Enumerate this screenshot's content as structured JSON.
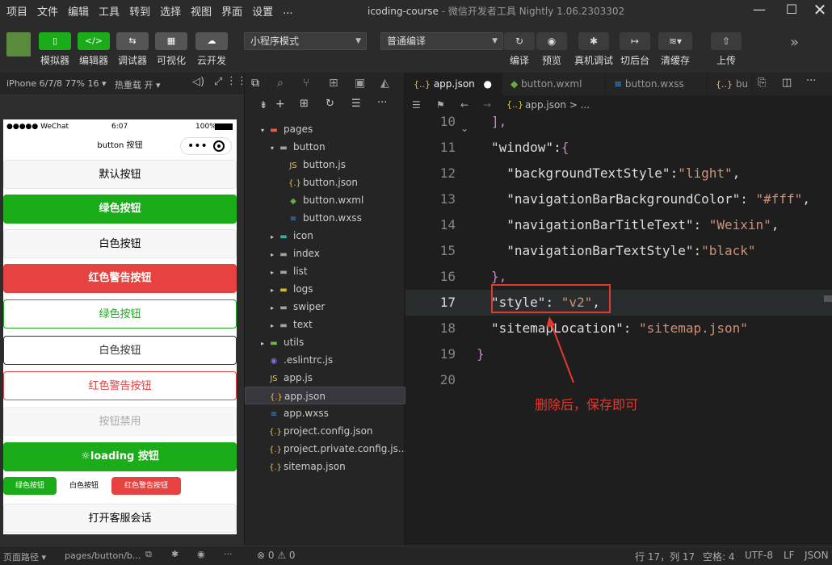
{
  "menu": [
    "项目",
    "文件",
    "编辑",
    "工具",
    "转到",
    "选择",
    "视图",
    "界面",
    "设置",
    "..."
  ],
  "window": {
    "title_app": "icoding-course",
    "title_rest": " - 微信开发者工具 Nightly 1.06.2303302"
  },
  "toolbar": {
    "simulator": "模拟器",
    "editor": "编辑器",
    "debugger": "调试器",
    "visual": "可视化",
    "cloud": "云开发",
    "mode_select": "小程序模式",
    "compile_select": "普通编译",
    "compile": "编译",
    "preview": "预览",
    "realdebug": "真机调试",
    "background": "切后台",
    "clearcache": "清缓存",
    "upload": "上传"
  },
  "simulator": {
    "device": "iPhone 6/7/8 77% 16",
    "hotreload": "热重载 开",
    "carrier": "●●●●● WeChat",
    "time": "6:07",
    "battery": "100%",
    "nav_title": "button 按钮",
    "buttons": {
      "default": "默认按钮",
      "green": "绿色按钮",
      "white": "白色按钮",
      "red": "红色警告按钮",
      "green_plain": "绿色按钮",
      "white_plain": "白色按钮",
      "red_plain": "红色警告按钮",
      "disabled": "按钮禁用",
      "loading": "loading 按钮",
      "mini_green": "绿色按钮",
      "mini_white": "白色按钮",
      "mini_red": "红色警告按钮",
      "contact": "打开客服会话"
    },
    "page_path_label": "页面路径",
    "page_path": "pages/button/b..."
  },
  "tree": [
    {
      "name": "pages",
      "depth": 0,
      "type": "folder-red",
      "caret": "▾"
    },
    {
      "name": "button",
      "depth": 1,
      "type": "folder",
      "caret": "▾"
    },
    {
      "name": "button.js",
      "depth": 2,
      "type": "js"
    },
    {
      "name": "button.json",
      "depth": 2,
      "type": "json"
    },
    {
      "name": "button.wxml",
      "depth": 2,
      "type": "wxml"
    },
    {
      "name": "button.wxss",
      "depth": 2,
      "type": "wxss"
    },
    {
      "name": "icon",
      "depth": 1,
      "type": "folder-teal",
      "caret": "▸"
    },
    {
      "name": "index",
      "depth": 1,
      "type": "folder",
      "caret": "▸"
    },
    {
      "name": "list",
      "depth": 1,
      "type": "folder",
      "caret": "▸"
    },
    {
      "name": "logs",
      "depth": 1,
      "type": "folder-yellow",
      "caret": "▸"
    },
    {
      "name": "swiper",
      "depth": 1,
      "type": "folder",
      "caret": "▸"
    },
    {
      "name": "text",
      "depth": 1,
      "type": "folder",
      "caret": "▸"
    },
    {
      "name": "utils",
      "depth": 0,
      "type": "folder-green",
      "caret": "▸"
    },
    {
      "name": ".eslintrc.js",
      "depth": 0,
      "type": "eslint"
    },
    {
      "name": "app.js",
      "depth": 0,
      "type": "js"
    },
    {
      "name": "app.json",
      "depth": 0,
      "type": "json",
      "selected": true
    },
    {
      "name": "app.wxss",
      "depth": 0,
      "type": "wxss"
    },
    {
      "name": "project.config.json",
      "depth": 0,
      "type": "json"
    },
    {
      "name": "project.private.config.js...",
      "depth": 0,
      "type": "json"
    },
    {
      "name": "sitemap.json",
      "depth": 0,
      "type": "json"
    }
  ],
  "tabs": [
    {
      "label": "app.json",
      "icon": "{..}"
    },
    {
      "label": "button.wxml",
      "icon": "◆"
    },
    {
      "label": "button.wxss",
      "icon": "≡"
    },
    {
      "label": "bu",
      "icon": "{..}"
    }
  ],
  "breadcrumb": "app.json > ...",
  "code": [
    {
      "n": "10",
      "segs": [
        [
          "p",
          "],"
        ]
      ]
    },
    {
      "n": "11",
      "segs": [
        [
          "k",
          "\"window\""
        ],
        [
          "k",
          ":"
        ],
        [
          "p",
          "{"
        ]
      ]
    },
    {
      "n": "12",
      "segs": [
        [
          "k",
          "  \"backgroundTextStyle\""
        ],
        [
          "k",
          ":"
        ],
        [
          "s",
          "\"light\""
        ],
        [
          "k",
          ","
        ]
      ]
    },
    {
      "n": "13",
      "segs": [
        [
          "k",
          "  \"navigationBarBackgroundColor\""
        ],
        [
          "k",
          ": "
        ],
        [
          "s",
          "\"#fff\""
        ],
        [
          "k",
          ","
        ]
      ]
    },
    {
      "n": "14",
      "segs": [
        [
          "k",
          "  \"navigationBarTitleText\""
        ],
        [
          "k",
          ": "
        ],
        [
          "s",
          "\"Weixin\""
        ],
        [
          "k",
          ","
        ]
      ]
    },
    {
      "n": "15",
      "segs": [
        [
          "k",
          "  \"navigationBarTextStyle\""
        ],
        [
          "k",
          ":"
        ],
        [
          "s",
          "\"black\""
        ]
      ]
    },
    {
      "n": "16",
      "segs": [
        [
          "p",
          "},"
        ]
      ]
    },
    {
      "n": "17",
      "segs": [
        [
          "k",
          "\"style\""
        ],
        [
          "k",
          ": "
        ],
        [
          "s",
          "\"v2\""
        ],
        [
          "k",
          ","
        ]
      ]
    },
    {
      "n": "18",
      "segs": [
        [
          "k",
          "\"sitemapLocation\""
        ],
        [
          "k",
          ": "
        ],
        [
          "s",
          "\"sitemap.json\""
        ]
      ]
    },
    {
      "n": "19",
      "segs": [
        [
          "p",
          "}"
        ]
      ]
    },
    {
      "n": "20",
      "segs": []
    }
  ],
  "annotation": "删除后，保存即可",
  "status": {
    "problems": "⊗ 0 ⚠ 0",
    "position": "行 17，列 17",
    "spaces": "空格: 4",
    "encoding": "UTF-8",
    "eol": "LF",
    "lang": "JSON"
  },
  "colors": {
    "wx_green": "#1aad19",
    "warn_red": "#e64340",
    "annotation_red": "#e33a2f"
  }
}
